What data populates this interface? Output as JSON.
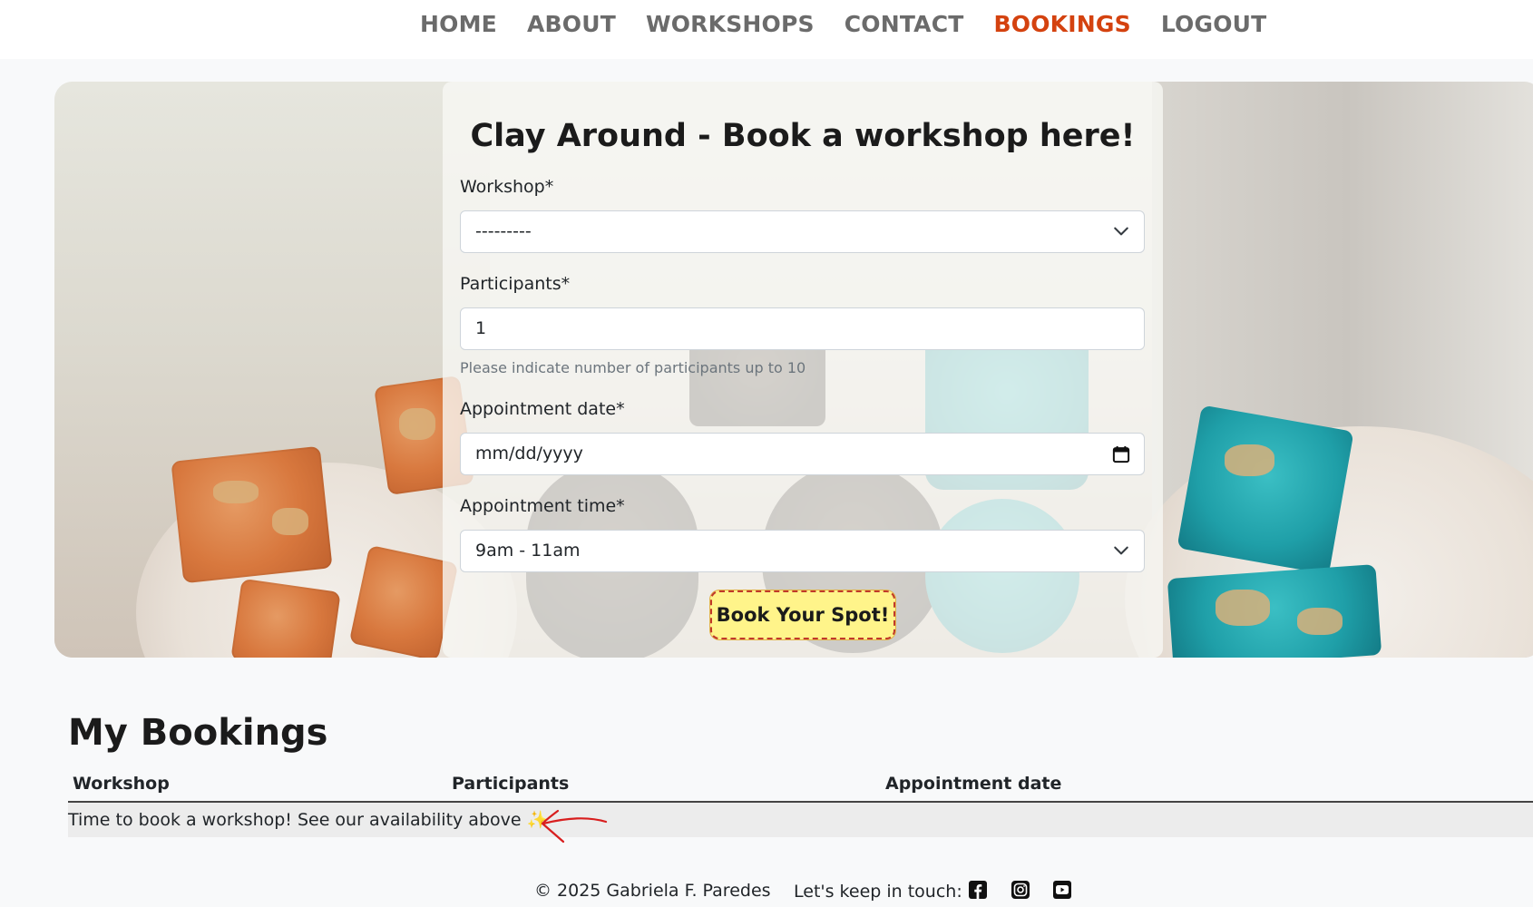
{
  "nav": {
    "items": [
      {
        "label": "HOME",
        "active": false
      },
      {
        "label": "ABOUT",
        "active": false
      },
      {
        "label": "WORKSHOPS",
        "active": false
      },
      {
        "label": "CONTACT",
        "active": false
      },
      {
        "label": "BOOKINGS",
        "active": true
      },
      {
        "label": "LOGOUT",
        "active": false
      }
    ],
    "active_color": "#d4420f"
  },
  "form": {
    "title": "Clay Around - Book a workshop here!",
    "workshop_label": "Workshop*",
    "workshop_value": "---------",
    "participants_label": "Participants*",
    "participants_value": "1",
    "participants_help": "Please indicate number of participants up to 10",
    "date_label": "Appointment date*",
    "date_placeholder": "mm/dd/yyyy",
    "time_label": "Appointment time*",
    "time_value": "9am - 11am",
    "submit_label": "Book Your Spot!"
  },
  "bookings": {
    "title": "My Bookings",
    "columns": [
      "Workshop",
      "Participants",
      "Appointment date"
    ],
    "empty_message": "Time to book a workshop! See our availability above ✨"
  },
  "footer": {
    "copyright": "© 2025 Gabriela F. Paredes",
    "social_label": "Let's keep in touch:",
    "social_icons": [
      "facebook-icon",
      "instagram-icon",
      "youtube-icon"
    ]
  }
}
